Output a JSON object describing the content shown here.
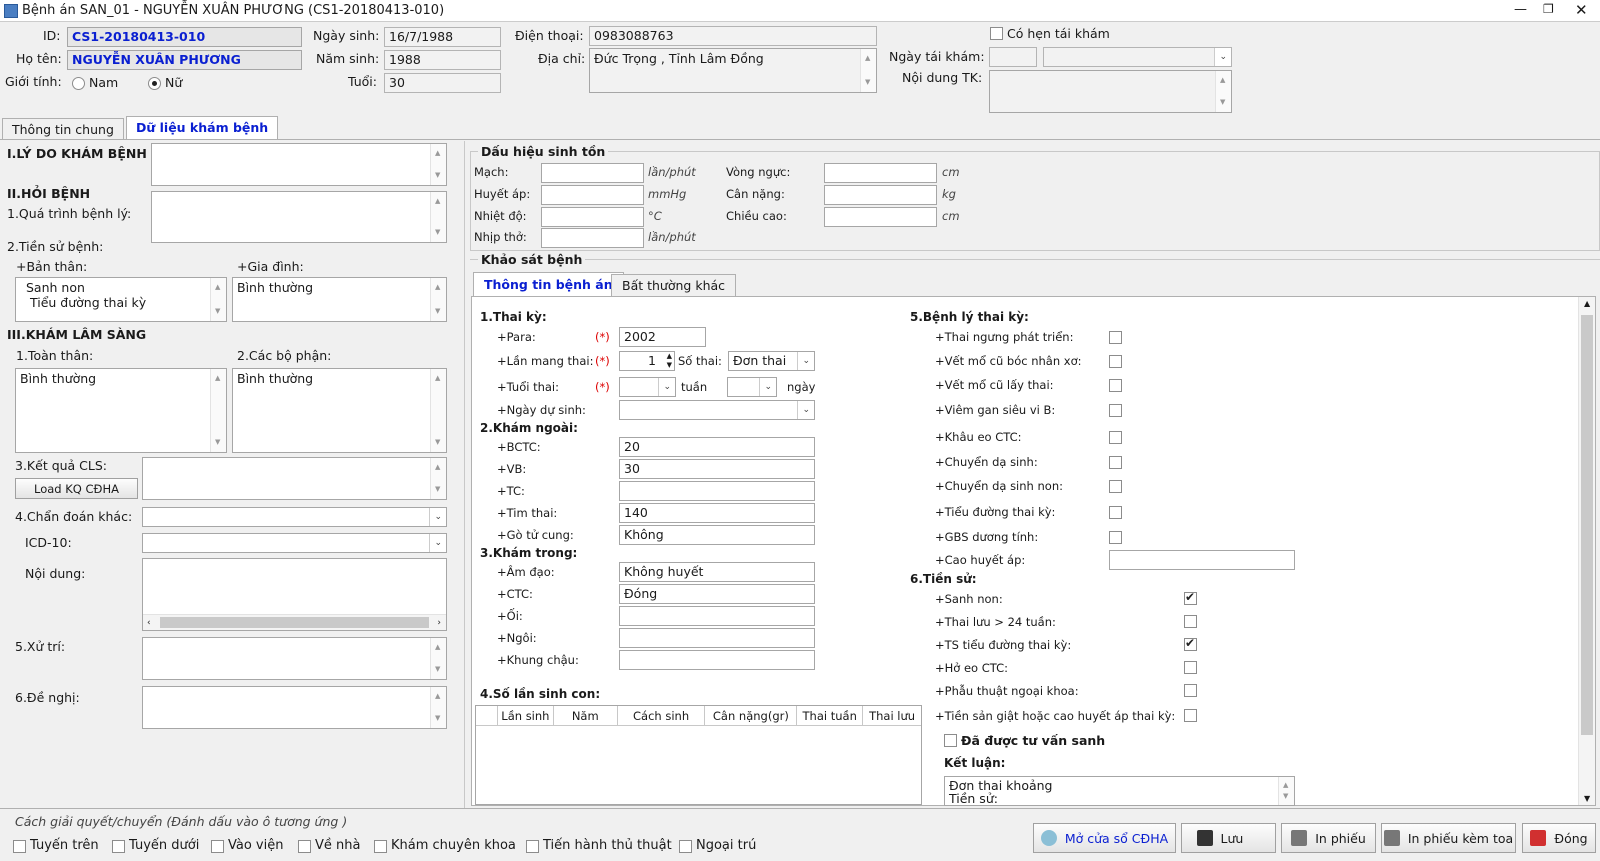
{
  "window": {
    "title": "Bệnh án SAN_01 - NGUYỄN XUÂN PHƯƠNG (CS1-20180413-010)"
  },
  "patient": {
    "id_label": "ID:",
    "id": "CS1-20180413-010",
    "name_label": "Họ tên:",
    "name": "NGUYỄN XUÂN PHƯƠNG",
    "gender_label": "Giới tính:",
    "male": "Nam",
    "female": "Nữ",
    "dob_label": "Ngày sinh:",
    "dob": "16/7/1988",
    "yob_label": "Năm sinh:",
    "yob": "1988",
    "age_label": "Tuổi:",
    "age": "30",
    "phone_label": "Điện thoại:",
    "phone": "0983088763",
    "address_label": "Địa chỉ:",
    "address": "Đức Trọng , Tỉnh Lâm Đồng",
    "followup_check": "Có hẹn tái khám",
    "followup_date_label": "Ngày tái khám:",
    "followup_content_label": "Nội dung TK:"
  },
  "tabs": [
    "Thông tin chung",
    "Dữ liệu khám bệnh"
  ],
  "left": {
    "reason": "I.LÝ DO KHÁM BỆNH",
    "history": "II.HỎI BỆNH",
    "process": "1.Quá trình bệnh lý:",
    "past": "2.Tiền sử bệnh:",
    "self": "+Bản thân:",
    "self_value": "Sanh non\n Tiểu đường thai kỳ",
    "family": "+Gia đình:",
    "family_value": "Bình thường",
    "exam": "III.KHÁM LÂM SÀNG",
    "general": "1.Toàn thân:",
    "general_value": "Bình thường",
    "parts": "2.Các bộ phận:",
    "parts_value": "Bình thường",
    "cls": "3.Kết quả CLS:",
    "load_btn": "Load KQ CĐHA",
    "diag": "4.Chẩn đoán khác:",
    "icd": "ICD-10:",
    "content": "Nội dung:",
    "treat": "5.Xử trí:",
    "suggest": "6.Đề nghị:"
  },
  "vitals": {
    "title": "Dấu hiệu sinh tồn",
    "rows_left": [
      {
        "label": "Mạch:",
        "unit": "lần/phút"
      },
      {
        "label": "Huyết áp:",
        "unit": "mmHg"
      },
      {
        "label": "Nhiệt độ:",
        "unit": "°C"
      },
      {
        "label": "Nhịp thở:",
        "unit": "lần/phút"
      }
    ],
    "rows_right": [
      {
        "label": "Vòng ngực:",
        "unit": "cm"
      },
      {
        "label": "Cân nặng:",
        "unit": "kg"
      },
      {
        "label": "Chiều cao:",
        "unit": "cm"
      }
    ]
  },
  "survey": {
    "title": "Khảo sát bệnh",
    "tabs": [
      "Thông tin bệnh án",
      "Bất thường khác"
    ],
    "preg": "1.Thai kỳ:",
    "para": "+Para:",
    "para_value": "2002",
    "req": "(*)",
    "times": "+Lần mang thai:",
    "times_value": "1",
    "count_label": "Số thai:",
    "count_value": "Đơn thai",
    "age": "+Tuổi thai:",
    "week": "tuần",
    "day": "ngày",
    "due": "+Ngày dự sinh:",
    "outer": "2.Khám ngoài:",
    "bctc": "+BCTC:",
    "bctc_value": "20",
    "vb": "+VB:",
    "vb_value": "30",
    "tc": "+TC:",
    "heart": "+Tim thai:",
    "heart_value": "140",
    "uterus": "+Gò tử cung:",
    "uterus_value": "Không",
    "inner": "3.Khám trong:",
    "vag": "+Âm đạo:",
    "vag_value": "Không huyết",
    "ctc": "+CTC:",
    "ctc_value": "Đóng",
    "oi": "+Ối:",
    "pos": "+Ngôi:",
    "pelvis": "+Khung chậu:",
    "births": "4.Số lần sinh con:",
    "cols": [
      "Lần sinh",
      "Năm",
      "Cách sinh",
      "Cân nặng(gr)",
      "Thai tuần",
      "Thai lưu"
    ],
    "path": "5.Bệnh lý thai kỳ:",
    "path_items": [
      "+Thai ngưng phát triển:",
      "+Vết mổ cũ bóc nhân xơ:",
      "+Vết mổ cũ lấy thai:",
      "+Viêm gan siêu vi B:",
      "+Khâu eo CTC:",
      "+Chuyển dạ sinh:",
      "+Chuyển dạ sinh non:",
      "+Tiểu đường thai kỳ:",
      "+GBS dương tính:"
    ],
    "hbp": "+Cao huyết áp:",
    "hist": "6.Tiền sử:",
    "hist_items": [
      "+Sanh non:",
      "+Thai lưu > 24 tuần:",
      "+TS tiểu đường thai kỳ:",
      "+Hở eo CTC:",
      "+Phẫu thuật ngoại khoa:",
      "+Tiền sản giật hoặc cao huyết áp thai kỳ:"
    ],
    "hist_checked": [
      true,
      false,
      true,
      false,
      false,
      false
    ],
    "consult": "Đã được tư vấn sanh",
    "conclusion": "Kết luận:",
    "conclusion_value": "Đơn thai khoảng\nTiền sử:"
  },
  "footer": {
    "legend": "Cách giải quyết/chuyển (Đánh dấu vào ô tương ứng )",
    "options": [
      "Tuyến trên",
      "Tuyến dưới",
      "Vào viện",
      "Về nhà",
      "Khám chuyên khoa",
      "Tiến hành thủ thuật",
      "Ngoại trú"
    ],
    "buttons": [
      "Mở cửa sổ CĐHA",
      "Lưu",
      "In phiếu",
      "In phiếu kèm toa",
      "Đóng"
    ]
  }
}
